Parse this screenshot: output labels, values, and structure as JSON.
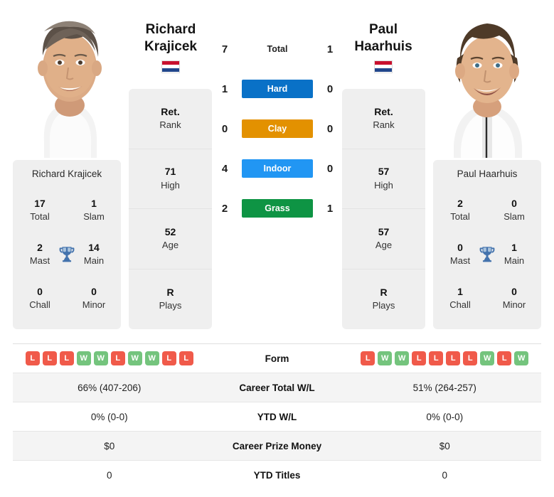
{
  "players": {
    "left": {
      "first_name": "Richard",
      "last_name": "Krajicek",
      "full_name": "Richard Krajicek",
      "country": "Netherlands",
      "flag_colors": [
        "#C8102E",
        "#FFFFFF",
        "#21468B"
      ],
      "titles": {
        "total_value": "17",
        "total_label": "Total",
        "slam_value": "1",
        "slam_label": "Slam",
        "mast_value": "2",
        "mast_label": "Mast",
        "main_value": "14",
        "main_label": "Main",
        "chall_value": "0",
        "chall_label": "Chall",
        "minor_value": "0",
        "minor_label": "Minor"
      },
      "ranks": [
        {
          "value": "Ret.",
          "label": "Rank"
        },
        {
          "value": "71",
          "label": "High"
        },
        {
          "value": "52",
          "label": "Age"
        },
        {
          "value": "R",
          "label": "Plays"
        }
      ],
      "form": [
        "L",
        "L",
        "L",
        "W",
        "W",
        "L",
        "W",
        "W",
        "L",
        "L"
      ],
      "career_total_wl": "66% (407-206)",
      "ytd_wl": "0% (0-0)",
      "career_prize_money": "$0",
      "ytd_titles": "0"
    },
    "right": {
      "first_name": "Paul",
      "last_name": "Haarhuis",
      "full_name": "Paul Haarhuis",
      "country": "Netherlands",
      "flag_colors": [
        "#C8102E",
        "#FFFFFF",
        "#21468B"
      ],
      "titles": {
        "total_value": "2",
        "total_label": "Total",
        "slam_value": "0",
        "slam_label": "Slam",
        "mast_value": "0",
        "mast_label": "Mast",
        "main_value": "1",
        "main_label": "Main",
        "chall_value": "1",
        "chall_label": "Chall",
        "minor_value": "0",
        "minor_label": "Minor"
      },
      "ranks": [
        {
          "value": "Ret.",
          "label": "Rank"
        },
        {
          "value": "57",
          "label": "High"
        },
        {
          "value": "57",
          "label": "Age"
        },
        {
          "value": "R",
          "label": "Plays"
        }
      ],
      "form": [
        "L",
        "W",
        "W",
        "L",
        "L",
        "L",
        "L",
        "W",
        "L",
        "W"
      ],
      "career_total_wl": "51% (264-257)",
      "ytd_wl": "0% (0-0)",
      "career_prize_money": "$0",
      "ytd_titles": "0"
    }
  },
  "h2h": {
    "total": {
      "label": "Total",
      "left": "7",
      "right": "1",
      "type": "plain"
    },
    "surfaces": [
      {
        "label": "Hard",
        "left": "1",
        "right": "0",
        "color": "#0971C7"
      },
      {
        "label": "Clay",
        "left": "0",
        "right": "0",
        "color": "#E39100"
      },
      {
        "label": "Indoor",
        "left": "4",
        "right": "0",
        "color": "#2196F3"
      },
      {
        "label": "Grass",
        "left": "2",
        "right": "1",
        "color": "#0E9444"
      }
    ]
  },
  "table": {
    "rows": [
      {
        "label": "Form",
        "left": "",
        "right": "",
        "kind": "form",
        "shaded": false
      },
      {
        "label": "Career Total W/L",
        "left": "66% (407-206)",
        "right": "51% (264-257)",
        "kind": "text",
        "shaded": true
      },
      {
        "label": "YTD W/L",
        "left": "0% (0-0)",
        "right": "0% (0-0)",
        "kind": "text",
        "shaded": false
      },
      {
        "label": "Career Prize Money",
        "left": "$0",
        "right": "$0",
        "kind": "text",
        "shaded": true
      },
      {
        "label": "YTD Titles",
        "left": "0",
        "right": "0",
        "kind": "text",
        "shaded": false
      }
    ]
  },
  "icons": {
    "trophy": "trophy-icon",
    "flag": "flag-icon"
  },
  "colors": {
    "win": "#74c47d",
    "loss": "#f05a4a",
    "card_bg": "#efefef",
    "row_shade": "#f4f4f4"
  }
}
